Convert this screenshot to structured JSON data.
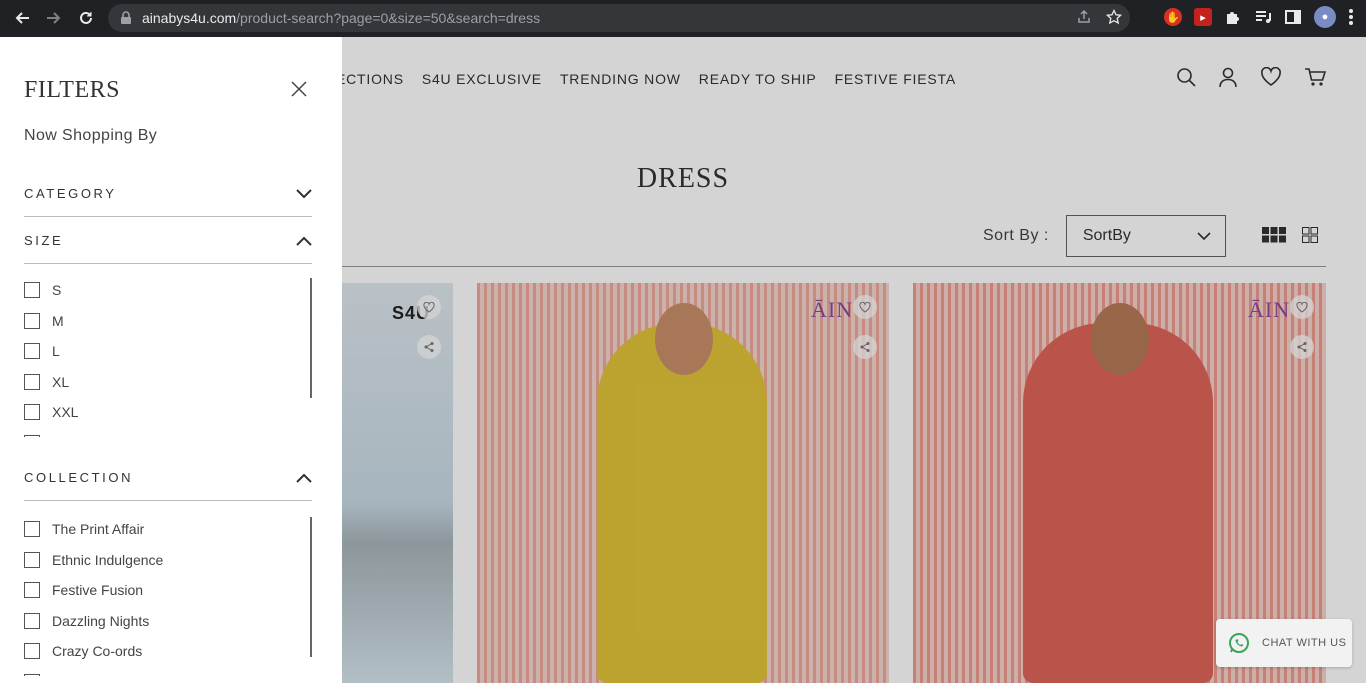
{
  "browser": {
    "url_host": "ainabys4u.com",
    "url_path": "/product-search?page=0&size=50&search=dress"
  },
  "header": {
    "menu": [
      "ECTIONS",
      "S4U EXCLUSIVE",
      "TRENDING NOW",
      "READY TO SHIP",
      "FESTIVE FIESTA"
    ],
    "icons": [
      "search-icon",
      "account-icon",
      "wishlist-icon",
      "cart-icon"
    ]
  },
  "main": {
    "page_title": "DRESS",
    "sort_label": "Sort By :",
    "sort_value": "SortBy",
    "products": [
      {
        "brand": "S4U",
        "tint": "#cfe2ea"
      },
      {
        "brand": "ĀIN",
        "tint": "#d9c13a"
      },
      {
        "brand": "ĀIN",
        "tint": "#e0685e"
      }
    ]
  },
  "filters": {
    "title": "FILTERS",
    "now_shopping_by": "Now Shopping By",
    "category_label": "CATEGORY",
    "size_label": "SIZE",
    "sizes": [
      "S",
      "M",
      "L",
      "XL",
      "XXL"
    ],
    "collection_label": "COLLECTION",
    "collections": [
      "The Print Affair",
      "Ethnic Indulgence",
      "Festive Fusion",
      "Dazzling Nights",
      "Crazy Co-ords"
    ]
  },
  "chat": {
    "label": "CHAT WITH US",
    "accent": "#3aa55a"
  }
}
